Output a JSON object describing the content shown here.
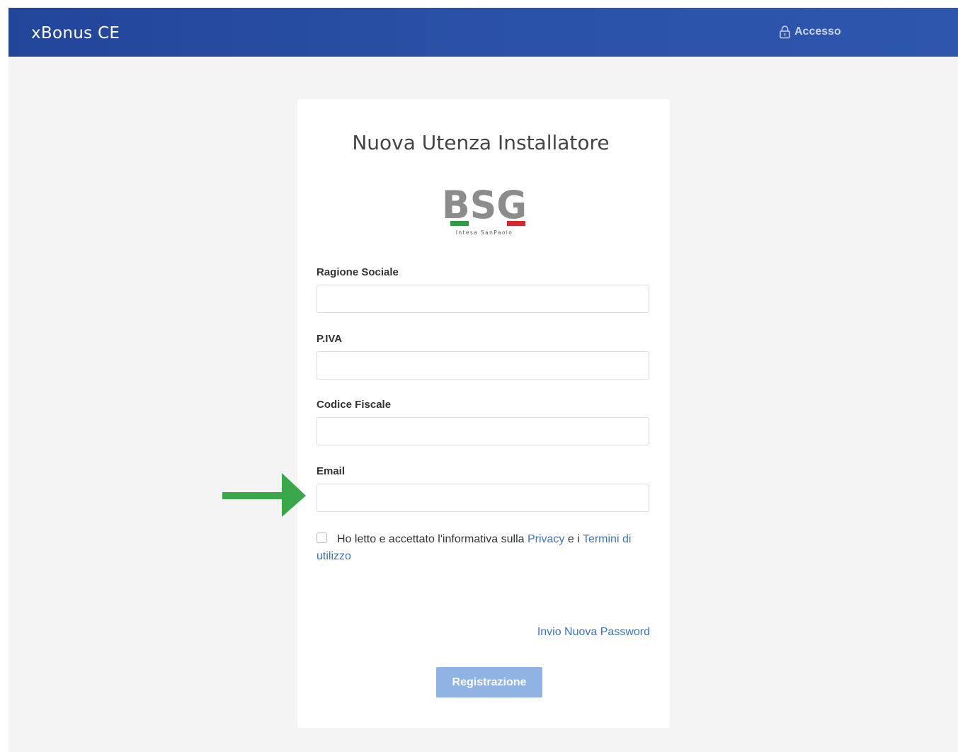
{
  "navbar": {
    "brand": "xBonus CE",
    "login_label": "Accesso",
    "login_icon": "lock-icon"
  },
  "form": {
    "title": "Nuova Utenza Installatore",
    "logo": {
      "text": "BSG",
      "subtitle": "Intesa SanPaolo"
    },
    "fields": [
      {
        "label": "Ragione Sociale",
        "value": "",
        "placeholder": ""
      },
      {
        "label": "P.IVA",
        "value": "",
        "placeholder": ""
      },
      {
        "label": "Codice Fiscale",
        "value": "",
        "placeholder": ""
      },
      {
        "label": "Email",
        "value": "",
        "placeholder": ""
      }
    ],
    "consent": {
      "checked": false,
      "text_before": "Ho letto e accettato l'informativa sulla",
      "privacy_link": "Privacy",
      "text_middle": "e i",
      "terms_link": "Termini di utilizzo"
    },
    "password_link": "Invio Nuova Password",
    "submit_label": "Registrazione"
  },
  "colors": {
    "navbar": "#2a52a8",
    "link": "#3a72c5",
    "button": "#8fb3e3",
    "annotation_arrow": "#3aa64a",
    "flag_green": "#2e9b45",
    "flag_red": "#d8262d"
  }
}
